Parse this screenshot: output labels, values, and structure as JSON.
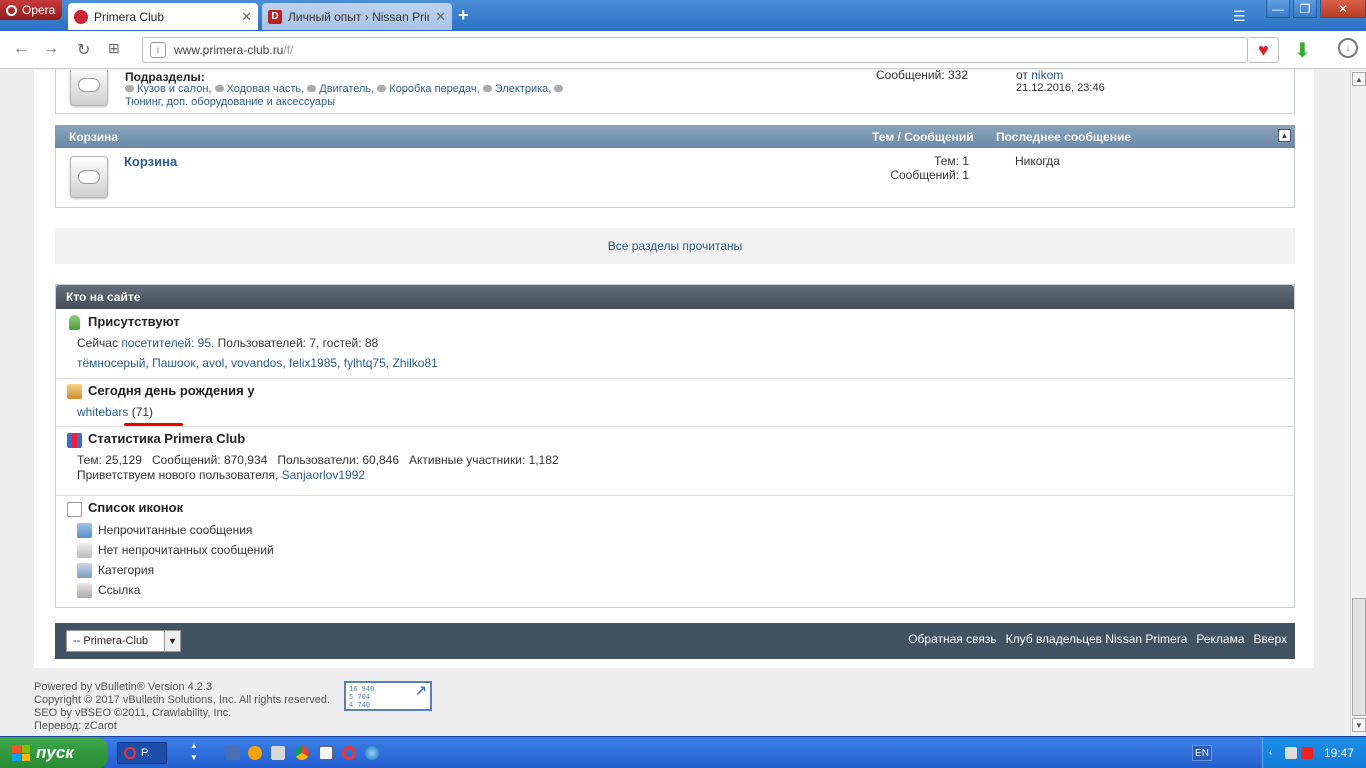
{
  "browser": {
    "menu_label": "Opera",
    "tabs": [
      {
        "title": "Primera Club",
        "active": true
      },
      {
        "title": "Личный опыт › Nissan Primera",
        "active": false
      }
    ],
    "url_host": "www.primera-club.ru",
    "url_path": "/f/"
  },
  "forum_top": {
    "subforums_label": "Подразделы:",
    "subforums": [
      "Кузов и салон",
      "Ходовая часть",
      "Двигатель",
      "Коробка передач",
      "Электрика",
      "Тюнинг, доп. оборудование и аксессуары"
    ],
    "posts": "Сообщений: 332",
    "last_from_prefix": "от",
    "last_user": "nikom",
    "last_date": "21.12.2016, 23:46"
  },
  "category": {
    "title": "Корзина",
    "col_stats": "Тем / Сообщений",
    "col_last": "Последнее сообщение",
    "forum_title": "Корзина",
    "threads": "Тем: 1",
    "posts": "Сообщений: 1",
    "last_post": "Никогда"
  },
  "mark_read": "Все разделы прочитаны",
  "wol": {
    "title": "Кто на сайте",
    "present_header": "Присутствуют",
    "present_prefix": "Сейчас",
    "visitors_link": "посетителей: 95",
    "present_rest": ". Пользователей: 7, гостей: 88",
    "users": [
      "тёмносерый",
      "Пашоок",
      "avol",
      "vovandos",
      "felix1985",
      "fylhtq75",
      "Zhilko81"
    ],
    "birthday_header": "Сегодня день рождения у",
    "birthday_user": "whitebars",
    "birthday_age": "(71)",
    "stats_header": "Статистика Primera Club",
    "stats_line": "Тем: 25,129   Сообщений: 870,934   Пользователи: 60,846   Активные участники: 1,182",
    "welcome_prefix": "Приветствуем нового пользователя,",
    "welcome_user": "Sanjaorlov1992",
    "icons_header": "Список иконок",
    "legend": [
      "Непрочитанные сообщения",
      "Нет непрочитанных сообщений",
      "Категория",
      "Ссылка"
    ]
  },
  "footer": {
    "style_select": "-- Primera-Club",
    "links": [
      "Обратная связь",
      "Клуб владельцев Nissan Primera",
      "Реклама",
      "Вверх"
    ]
  },
  "copyright": [
    "Powered by vBulletin® Version 4.2.3",
    "Copyright © 2017 vBulletin Solutions, Inc. All rights reserved.",
    "SEO by vBSEO ©2011, Crawlability, Inc.",
    "Перевод: zCarot"
  ],
  "counter": [
    "16 940",
    "5 704",
    "4 740"
  ],
  "taskbar": {
    "start_label": "пуск",
    "task_label": "P.",
    "lang": "EN",
    "time": "19:47"
  },
  "colors": {
    "link": "#2a5d86",
    "category_head": "#7b97b1",
    "wol_head": "#4f5b66",
    "footer_bar": "#415363",
    "taskbar": "#245ecf",
    "start": "#3da74a"
  }
}
